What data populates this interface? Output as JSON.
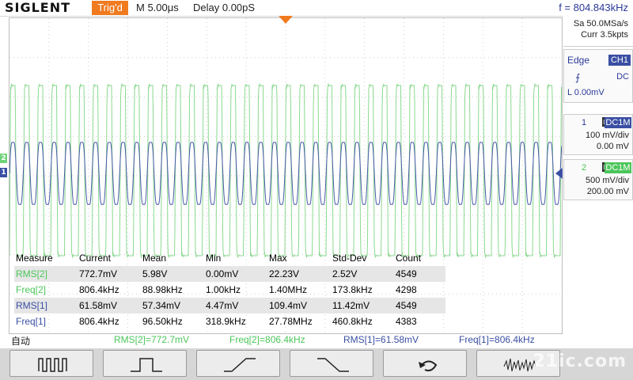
{
  "header": {
    "brand": "SIGLENT",
    "trigger_status": "Trig'd",
    "timebase": "M 5.00μs",
    "delay": "Delay 0.00pS",
    "frequency": "f = 804.843kHz"
  },
  "acquisition": {
    "sample_rate": "Sa 50.0MSa/s",
    "memory": "Curr 3.5kpts"
  },
  "trigger": {
    "type": "Edge",
    "source": "CH1",
    "slope_icon": "rising-edge-icon",
    "coupling": "DC",
    "level": "L  0.00mV"
  },
  "channels": [
    {
      "number": "1",
      "coupling": "DC1M",
      "scale": "100 mV/div",
      "offset": "0.00 mV",
      "color": "#3a4fa3"
    },
    {
      "number": "2",
      "coupling": "DC1M",
      "scale": "500 mV/div",
      "offset": "200.00 mV",
      "color": "#6fd37a"
    }
  ],
  "measure": {
    "headers": [
      "Measure",
      "Current",
      "Mean",
      "Min",
      "Max",
      "Std-Dev",
      "Count"
    ],
    "rows": [
      {
        "cells": [
          "RMS[2]",
          "772.7mV",
          "5.98V",
          "0.00mV",
          "22.23V",
          "2.52V",
          "4549"
        ],
        "color": "#6fd37a"
      },
      {
        "cells": [
          "Freq[2]",
          "806.4kHz",
          "88.98kHz",
          "1.00kHz",
          "1.40MHz",
          "173.8kHz",
          "4298"
        ],
        "color": "#6fd37a"
      },
      {
        "cells": [
          "RMS[1]",
          "61.58mV",
          "57.34mV",
          "4.47mV",
          "109.4mV",
          "11.42mV",
          "4549"
        ],
        "color": "#3a4fa3"
      },
      {
        "cells": [
          "Freq[1]",
          "806.4kHz",
          "96.50kHz",
          "318.9kHz",
          "27.78MHz",
          "460.8kHz",
          "4383"
        ],
        "color": "#3a4fa3"
      }
    ]
  },
  "status_line": {
    "mode": "自动",
    "items": [
      {
        "text": "RMS[2]=772.7mV",
        "color": "#4cc65a"
      },
      {
        "text": "Freq[2]=806.4kHz",
        "color": "#4cc65a"
      },
      {
        "text": "RMS[1]=61.58mV",
        "color": "#3a4fa3"
      },
      {
        "text": "Freq[1]=806.4kHz",
        "color": "#3a4fa3"
      }
    ]
  },
  "softkeys": [
    {
      "icon": "pulse-train-icon"
    },
    {
      "icon": "single-pulse-icon"
    },
    {
      "icon": "rising-ramp-icon"
    },
    {
      "icon": "falling-ramp-icon"
    },
    {
      "icon": "undo-arrow-icon"
    },
    {
      "icon": "noisy-waveform-icon"
    }
  ],
  "watermark": "21ic.com"
}
